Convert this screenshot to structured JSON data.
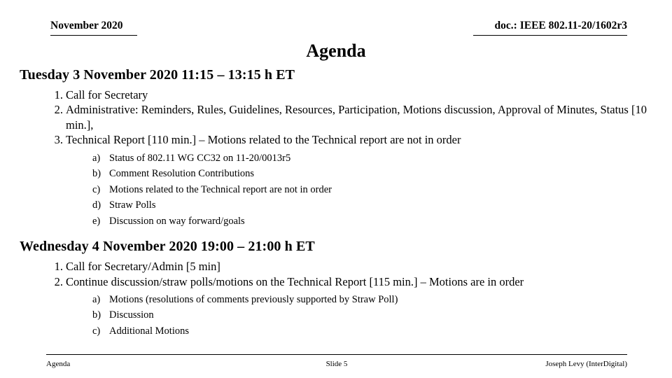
{
  "header": {
    "left": "November 2020",
    "right": "doc.: IEEE 802.11-20/1602r3"
  },
  "title": "Agenda",
  "sections": [
    {
      "heading": "Tuesday 3 November 2020 11:15 – 13:15 h ET",
      "items": [
        {
          "marker": "1.",
          "text": "Call for Secretary",
          "sub": []
        },
        {
          "marker": "2.",
          "text": "Administrative: Reminders, Rules, Guidelines, Resources,  Participation, Motions discussion, Approval of Minutes, Status [10 min.],",
          "sub": []
        },
        {
          "marker": "3.",
          "text": "Technical Report [110 min.] – Motions related to the Technical report are not in order",
          "sub": [
            {
              "marker": "a)",
              "text": "Status of 802.11 WG CC32 on 11-20/0013r5"
            },
            {
              "marker": "b)",
              "text": "Comment Resolution Contributions"
            },
            {
              "marker": "c)",
              "text": "Motions related to the Technical report are not in order"
            },
            {
              "marker": "d)",
              "text": "Straw Polls"
            },
            {
              "marker": "e)",
              "text": "Discussion on way forward/goals"
            }
          ]
        }
      ]
    },
    {
      "heading": "Wednesday 4 November 2020 19:00 – 21:00 h ET",
      "items": [
        {
          "marker": "1.",
          "text": "Call for Secretary/Admin [5 min]",
          "sub": []
        },
        {
          "marker": "2.",
          "text": "Continue discussion/straw polls/motions on the Technical Report [115 min.] – Motions are in order",
          "sub": [
            {
              "marker": "a)",
              "text": "Motions (resolutions of comments previously supported by Straw Poll)"
            },
            {
              "marker": "b)",
              "text": "Discussion"
            },
            {
              "marker": "c)",
              "text": "Additional Motions"
            }
          ]
        }
      ]
    }
  ],
  "footer": {
    "left": "Agenda",
    "center": "Slide 5",
    "right": "Joseph Levy (InterDigital)"
  }
}
